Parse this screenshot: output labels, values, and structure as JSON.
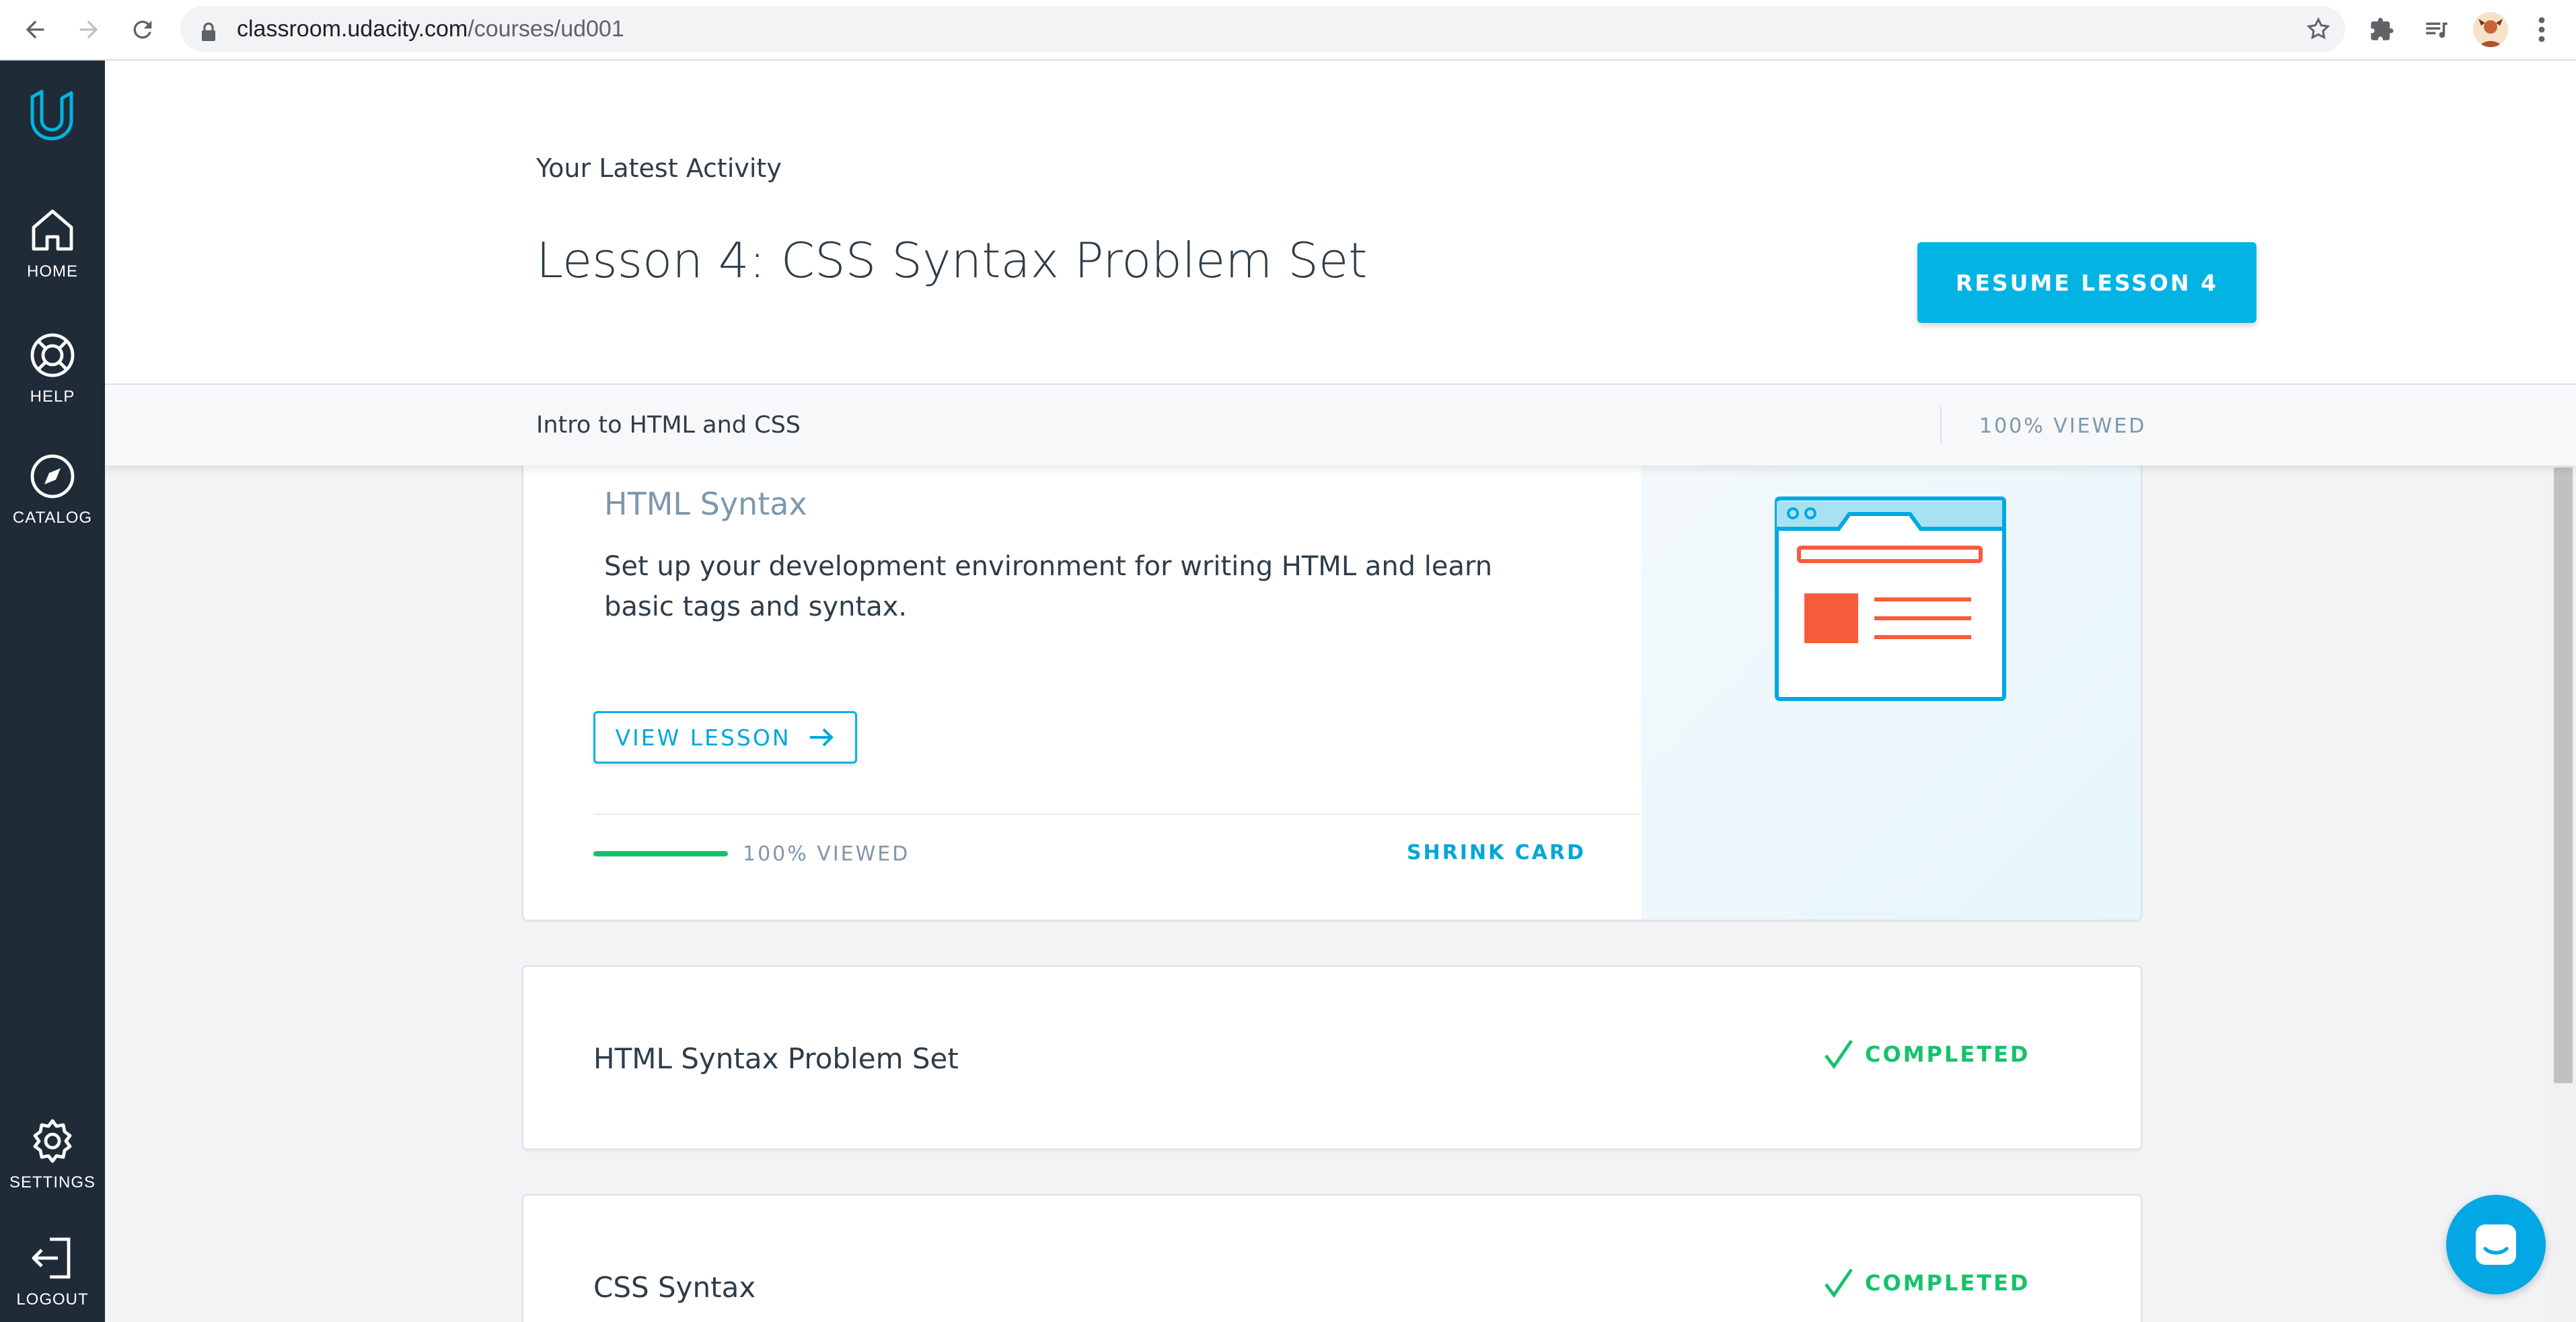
{
  "browser": {
    "url_host": "classroom.udacity.com",
    "url_path": "/courses/ud001"
  },
  "sidebar": {
    "items": [
      {
        "label": "HOME"
      },
      {
        "label": "HELP"
      },
      {
        "label": "CATALOG"
      },
      {
        "label": "SETTINGS"
      },
      {
        "label": "LOGOUT"
      }
    ]
  },
  "activity": {
    "heading": "Your Latest Activity",
    "lesson_title": "Lesson 4: CSS Syntax Problem Set",
    "resume_label": "RESUME LESSON 4"
  },
  "course_bar": {
    "course_name": "Intro to HTML and CSS",
    "viewed": "100% VIEWED"
  },
  "lessons": {
    "expanded": {
      "title": "HTML Syntax",
      "description": "Set up your development environment for writing HTML and learn basic tags and syntax.",
      "view_label": "VIEW LESSON",
      "progress_fraction": 1.0,
      "viewed": "100% VIEWED",
      "shrink_label": "SHRINK CARD"
    },
    "rows": [
      {
        "title": "HTML Syntax Problem Set",
        "status": "COMPLETED"
      },
      {
        "title": "CSS Syntax",
        "status": "COMPLETED"
      }
    ]
  },
  "colors": {
    "accent": "#02b3e4",
    "sidebar": "#1f2b37",
    "success": "#15c26b",
    "illustration": "#f95c3c"
  }
}
